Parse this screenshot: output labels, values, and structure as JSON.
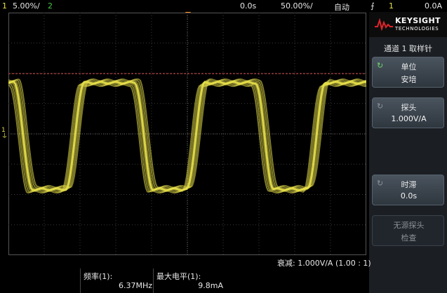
{
  "status_bar": {
    "ch1_label": "1",
    "ch1_scale": "5.00%/",
    "ch2_label": "2",
    "time_position": "0.0s",
    "time_scale": "50.00%/",
    "trigger_mode": "自动",
    "trigger_symbol": "⨍",
    "trigger_source": "1",
    "trigger_level": "0.0A"
  },
  "brand": {
    "name": "KEYSIGHT",
    "subtitle": "TECHNOLOGIES"
  },
  "menu": {
    "title": "通道 1 取样针",
    "softkeys": [
      {
        "label": "单位",
        "value": "安培",
        "icon": "refresh-arrow-icon",
        "enabled": true
      },
      {
        "label": "探头",
        "value": "1.000V/A",
        "icon": "refresh-arrow-icon",
        "enabled": true
      },
      {
        "label": "时滞",
        "value": "0.0s",
        "icon": "refresh-arrow-icon",
        "enabled": true
      },
      {
        "label": "无源探头",
        "value": "检查",
        "icon": "",
        "enabled": false
      }
    ]
  },
  "attenuation": "衰减: 1.000V/A (1.00 : 1)",
  "measurements": [
    {
      "label": "频率(1):",
      "value": "6.37MHz"
    },
    {
      "label": "最大电平(1):",
      "value": "9.8mA"
    }
  ],
  "colors": {
    "channel1": "#e8e04a",
    "channel2": "#46c846",
    "trigger": "#ff8a1a",
    "ref_line": "#d85050"
  },
  "ch1_marker": "1"
}
